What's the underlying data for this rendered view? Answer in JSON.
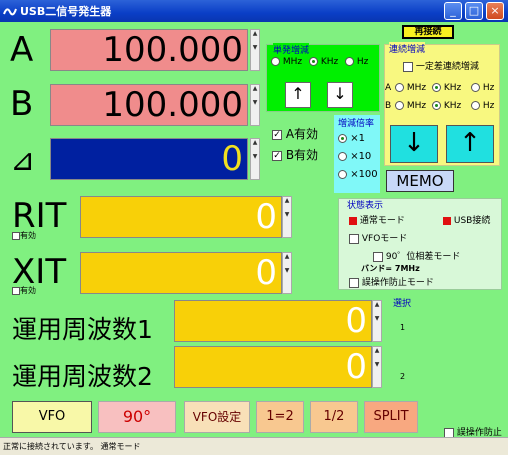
{
  "window": {
    "title": "USB二信号発生器"
  },
  "reconnect": {
    "label": "再接続"
  },
  "freq": {
    "a": {
      "label": "A",
      "value": "100.000"
    },
    "b": {
      "label": "B",
      "value": "100.000"
    },
    "delta": {
      "label": "⊿",
      "value": "0"
    },
    "rit": {
      "label": "RIT",
      "value": "0",
      "enable": "有効"
    },
    "xit": {
      "label": "XIT",
      "value": "0",
      "enable": "有効"
    },
    "op1": {
      "label": "運用周波数1",
      "value": "0"
    },
    "op2": {
      "label": "運用周波数2",
      "value": "0"
    }
  },
  "step": {
    "title": "単発増減",
    "units": [
      "MHz",
      "KHz",
      "Hz"
    ],
    "selected": "KHz",
    "up": "↑",
    "down": "↓"
  },
  "enables": {
    "a": "A有効",
    "b": "B有効"
  },
  "multiplier": {
    "title": "増減倍率",
    "options": [
      "×1",
      "×10",
      "×100"
    ],
    "selected": "×1"
  },
  "continuous": {
    "title": "連続増減",
    "constant": "一定差連続増減",
    "row_a": "A",
    "row_b": "B",
    "units": [
      "MHz",
      "KHz",
      "Hz"
    ],
    "selected_a": "KHz",
    "selected_b": "KHz",
    "down": "↓",
    "up": "↑"
  },
  "memo": {
    "label": "MEMO"
  },
  "status": {
    "title": "状態表示",
    "normal_mode": "通常モード",
    "usb": "USB接続",
    "vfo_mode": "VFOモード",
    "phase_mode": "90゜位相差モード",
    "band": "バンド= 7MHz",
    "misop_mode": "誤操作防止モード"
  },
  "select": {
    "title": "選択",
    "one": "1",
    "two": "2"
  },
  "bottom": {
    "vfo": "VFO",
    "ninety": "90°",
    "vfo_settings": "VFO設定",
    "one_eq_two": "1=2",
    "half": "1/2",
    "split": "SPLIT",
    "prevent": "誤操作防止"
  },
  "statusbar": {
    "text": "正常に接続されています。 通常モード"
  },
  "colors": {
    "a_field": "#f08c8c",
    "b_field": "#f08c8c",
    "delta_field": "#0020a0",
    "delta_text": "#f0e020",
    "inactive_field": "#f8d008",
    "step_panel": "#00f000",
    "multiplier_panel": "#80f8f8",
    "continuous_panel": "#f8f880"
  }
}
